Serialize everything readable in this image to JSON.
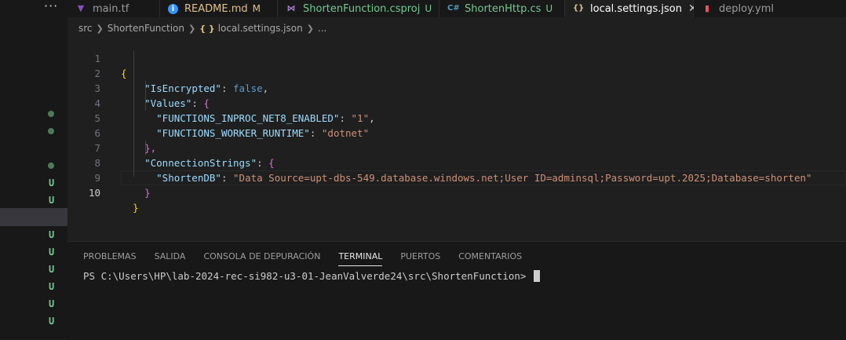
{
  "sidebar": {
    "more_label": "···",
    "badges": [
      "U",
      "U",
      "U",
      "U",
      "U",
      "U",
      "U"
    ]
  },
  "tabs": [
    {
      "label": "main.tf",
      "icon": "terraform-icon",
      "suffix": "",
      "color": "#9d9d9d"
    },
    {
      "label": "README.md",
      "icon": "info-icon",
      "suffix": "M",
      "color": "#e2c08d"
    },
    {
      "label": "ShortenFunction.csproj",
      "icon": "visual-studio-icon",
      "suffix": "U",
      "color": "#73c991"
    },
    {
      "label": "ShortenHttp.cs",
      "icon": "csharp-icon",
      "suffix": "U",
      "color": "#73c991"
    },
    {
      "label": "local.settings.json",
      "icon": "json-icon",
      "suffix": "",
      "color": "#ffffff",
      "active": true
    },
    {
      "label": "deploy.yml",
      "icon": "yaml-icon",
      "suffix": "",
      "color": "#9d9d9d"
    }
  ],
  "tab_close_glyph": "✕",
  "breadcrumb": {
    "src": "src",
    "folder": "ShortenFunction",
    "file_icon": "{ }",
    "file": "local.settings.json",
    "tail": "..."
  },
  "editor": {
    "line_numbers": [
      "1",
      "2",
      "3",
      "4",
      "5",
      "6",
      "7",
      "8",
      "9",
      "10"
    ],
    "current_line": "10",
    "tokens": {
      "open_brace": "{",
      "close_brace": "}",
      "is_encrypted_key": "\"IsEncrypted\"",
      "false_kw": "false",
      "values_key": "\"Values\"",
      "inproc_key": "\"FUNCTIONS_INPROC_NET8_ENABLED\"",
      "inproc_val": "\"1\"",
      "runtime_key": "\"FUNCTIONS_WORKER_RUNTIME\"",
      "runtime_val": "\"dotnet\"",
      "conn_key": "\"ConnectionStrings\"",
      "shorten_key": "\"ShortenDB\"",
      "shorten_val": "\"Data Source=upt-dbs-549.database.windows.net;User ID=adminsql;Password=upt.2025;Database=shorten\"",
      "colon": ": ",
      "comma": ",",
      "close_brace_comma": "},"
    }
  },
  "panel": {
    "tabs": [
      "PROBLEMAS",
      "SALIDA",
      "CONSOLA DE DEPURACIÓN",
      "TERMINAL",
      "PUERTOS",
      "COMENTARIOS"
    ],
    "active_tab": "TERMINAL",
    "prompt": "PS C:\\Users\\HP\\lab-2024-rec-si982-u3-01-JeanValverde24\\src\\ShortenFunction> "
  }
}
